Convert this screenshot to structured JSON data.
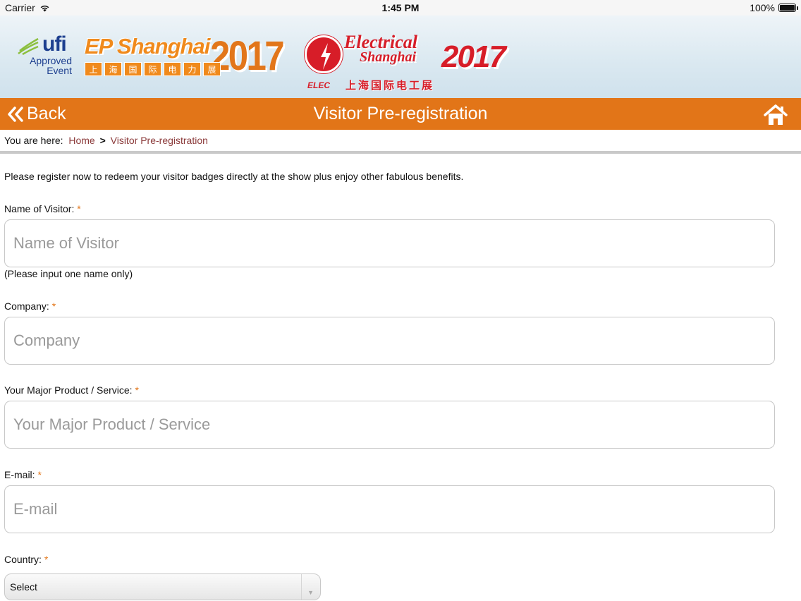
{
  "status_bar": {
    "carrier": "Carrier",
    "time": "1:45 PM",
    "battery": "100%",
    "battery_level": 1.0
  },
  "banner": {
    "ufi": {
      "name": "ufi",
      "line1": "Approved",
      "line2": "Event"
    },
    "ep_logo": {
      "name": "EP Shanghai",
      "year": "2017",
      "chinese": [
        "上",
        "海",
        "国",
        "际",
        "电",
        "力",
        "展"
      ]
    },
    "electrical_logo": {
      "line1": "Electrical",
      "line2": "Shanghai",
      "year": "2017",
      "badge": "ELEC",
      "chinese": "上海国际电工展"
    }
  },
  "navbar": {
    "back_label": "Back",
    "title": "Visitor Pre-registration",
    "home_icon": "home-icon",
    "back_icon": "double-chevron-left-icon",
    "color": "#e27518"
  },
  "breadcrumb": {
    "prefix": "You are here:",
    "home": "Home",
    "separator": ">",
    "current": "Visitor Pre-registration",
    "link_color": "#8b3a3a"
  },
  "form": {
    "intro": "Please register now to redeem your visitor badges directly at the show plus enjoy other fabulous benefits.",
    "required_mark": "*",
    "fields": [
      {
        "label": "Name of Visitor:",
        "placeholder": "Name of Visitor",
        "hint": "(Please input one name only)",
        "value": ""
      },
      {
        "label": "Company:",
        "placeholder": "Company",
        "value": ""
      },
      {
        "label": "Your Major Product / Service:",
        "placeholder": "Your Major Product / Service",
        "value": ""
      },
      {
        "label": "E-mail:",
        "placeholder": "E-mail",
        "value": ""
      }
    ],
    "country": {
      "label": "Country:",
      "selected": "Select"
    }
  }
}
